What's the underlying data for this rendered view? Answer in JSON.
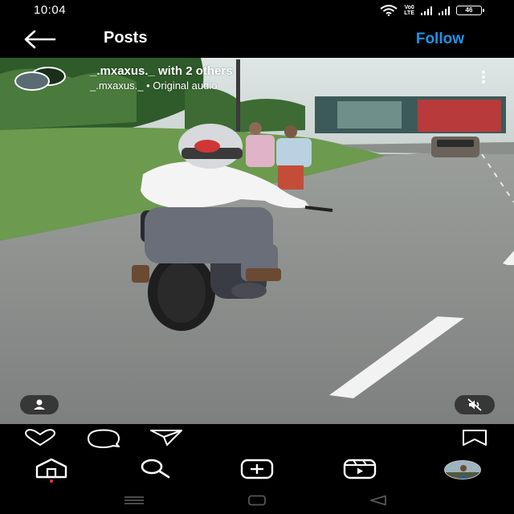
{
  "status_bar": {
    "time": "10:04",
    "volte_top": "Vo0",
    "volte_bottom": "LTE",
    "battery": "46"
  },
  "header": {
    "title": "Posts",
    "follow_label": "Follow",
    "back_icon": "arrow-left-icon"
  },
  "post": {
    "user_line": "_.mxaxus._ with 2 others",
    "audio_line": "_.mxaxus._ • Original audio",
    "more_icon": "vertical-ellipsis-icon",
    "tag_icon": "person-tag-icon",
    "mute_icon": "speaker-muted-icon"
  },
  "actions": {
    "like_icon": "heart-icon",
    "comment_icon": "comment-icon",
    "share_icon": "paper-plane-icon",
    "save_icon": "bookmark-icon"
  },
  "bottom_nav": {
    "items": [
      "home-icon",
      "search-icon",
      "new-post-icon",
      "reels-icon",
      "profile-avatar"
    ],
    "notification_dot_color": "#ff3040"
  },
  "system_nav": {
    "items": [
      "recents-icon",
      "home-square-icon",
      "back-triangle-icon"
    ]
  },
  "colors": {
    "accent": "#1b95ea",
    "background": "#000000"
  }
}
